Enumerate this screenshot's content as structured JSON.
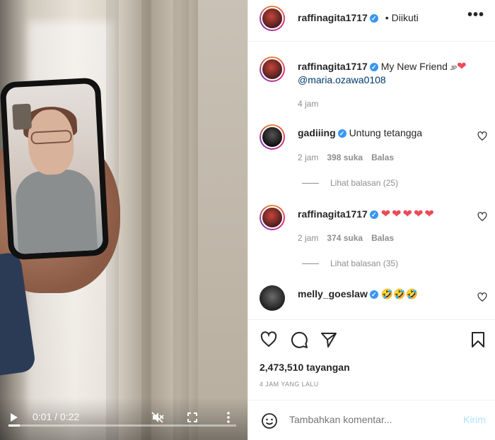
{
  "video": {
    "time_current": "0:01",
    "time_total": "0:22",
    "time_display": "0:01 / 0:22",
    "progress": 0.05,
    "icons": [
      "play-icon",
      "mute-icon",
      "fullscreen-icon",
      "more-vertical-icon"
    ]
  },
  "header": {
    "username": "raffinagita1717",
    "separator": "•",
    "follow_status": "Diikuti",
    "more_label": "•••"
  },
  "caption": {
    "username": "raffinagita1717",
    "text": "My New Friend",
    "flag": "JP",
    "mention": "@maria.ozawa0108",
    "time": "4 jam"
  },
  "comments": [
    {
      "username": "gadiiing",
      "text": "Untung tetangga",
      "time": "2 jam",
      "likes": "398 suka",
      "reply_label": "Balas",
      "view_replies": "Lihat balasan (25)"
    },
    {
      "username": "raffinagita1717",
      "text": "❤❤❤❤❤",
      "time": "2 jam",
      "likes": "374 suka",
      "reply_label": "Balas",
      "view_replies": "Lihat balasan (35)"
    },
    {
      "username": "melly_goeslaw",
      "text": "🤣🤣🤣"
    }
  ],
  "actions": {
    "views": "2,473,510 tayangan",
    "posted_ago": "4 JAM YANG LALU"
  },
  "comment_box": {
    "placeholder": "Tambahkan komentar...",
    "post_label": "Kirim"
  },
  "colors": {
    "verified": "#3897f0",
    "heart_red": "#ed4956",
    "post_disabled": "#b2dffc",
    "mention": "#00376b"
  }
}
